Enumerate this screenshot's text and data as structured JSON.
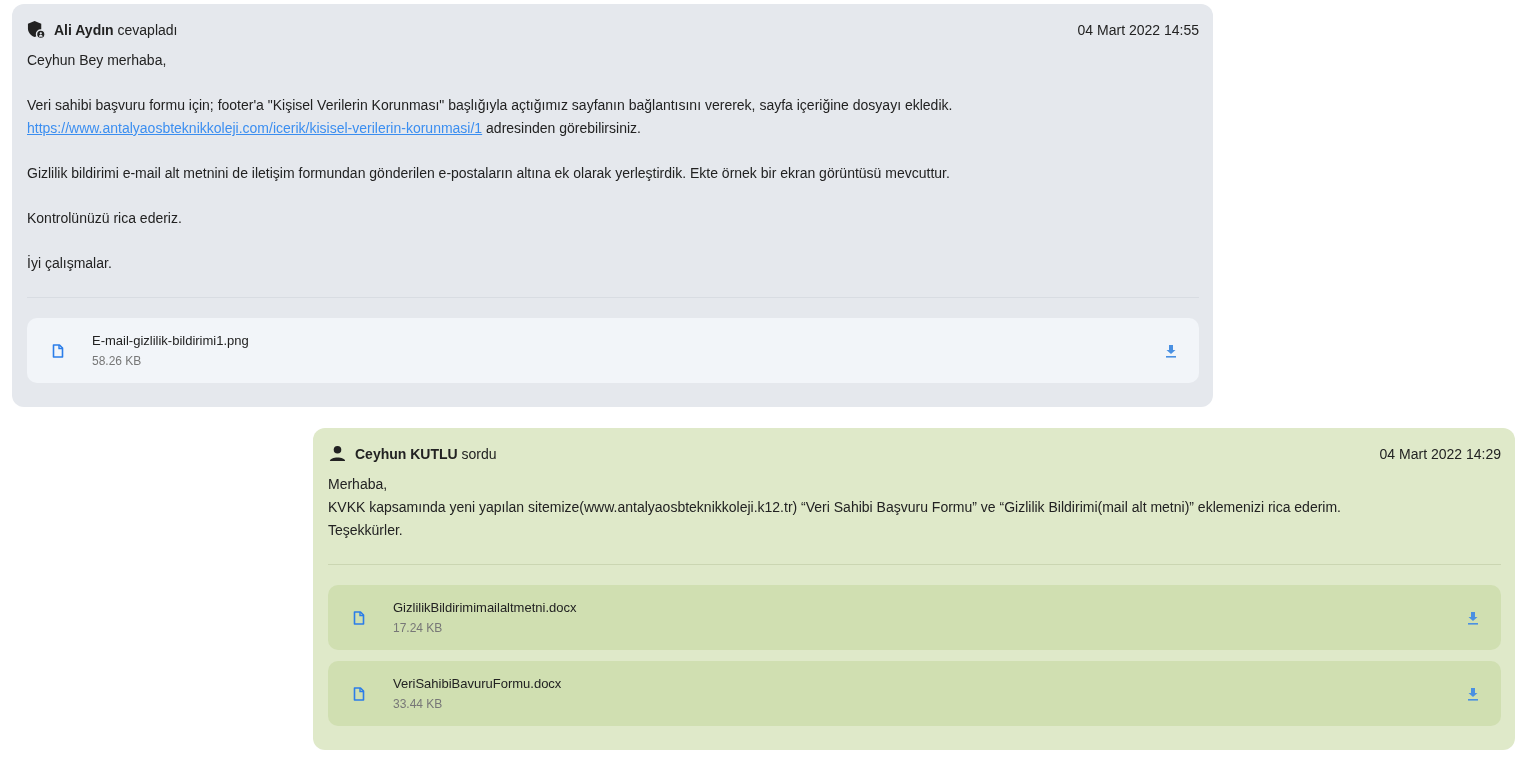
{
  "messages": [
    {
      "kind": "reply",
      "author": "**Ali Aydın** cevapladı",
      "date": "04 Mart 2022 14:55",
      "paragraphs": [
        [
          {
            "text": "Ceyhun Bey merhaba,"
          }
        ],
        [
          {
            "text": "Veri sahibi başvuru formu için; footer'a \"Kişisel Verilerin Korunması\" başlığıyla açtığımız sayfanın bağlantısını vererek, sayfa içeriğine dosyayı ekledik."
          },
          {
            "link": "https://www.antalyaosbteknikkoleji.com/icerik/kisisel-verilerin-korunmasi/1",
            "text": " adresinden görebilirsiniz."
          }
        ],
        [
          {
            "text": "Gizlilik bildirimi e-mail alt metnini de iletişim formundan gönderilen e-postaların altına ek olarak yerleştirdik. Ekte örnek bir ekran görüntüsü mevcuttur."
          }
        ],
        [
          {
            "text": "Kontrolünüzü rica ederiz."
          }
        ],
        [
          {
            "text": "İyi çalışmalar."
          }
        ]
      ],
      "attachments": [
        {
          "name": "E-mail-gizlilik-bildirimi1.png",
          "size": "58.26 KB"
        }
      ]
    },
    {
      "kind": "question",
      "author": "**Ceyhun KUTLU** sordu",
      "date": "04 Mart 2022 14:29",
      "paragraphs": [
        [
          {
            "text": "Merhaba,"
          },
          {
            "text": "KVKK kapsamında yeni yapılan sitemize(www.antalyaosbteknikkoleji.k12.tr) “Veri Sahibi Başvuru Formu” ve “Gizlilik Bildirimi(mail alt metni)” eklemenizi rica ederim."
          },
          {
            "text": "Teşekkürler."
          }
        ]
      ],
      "attachments": [
        {
          "name": "GizlilikBildirimimailaltmetni.docx",
          "size": "17.24 KB"
        },
        {
          "name": "VeriSahibiBavuruFormu.docx",
          "size": "33.44 KB"
        }
      ]
    }
  ]
}
